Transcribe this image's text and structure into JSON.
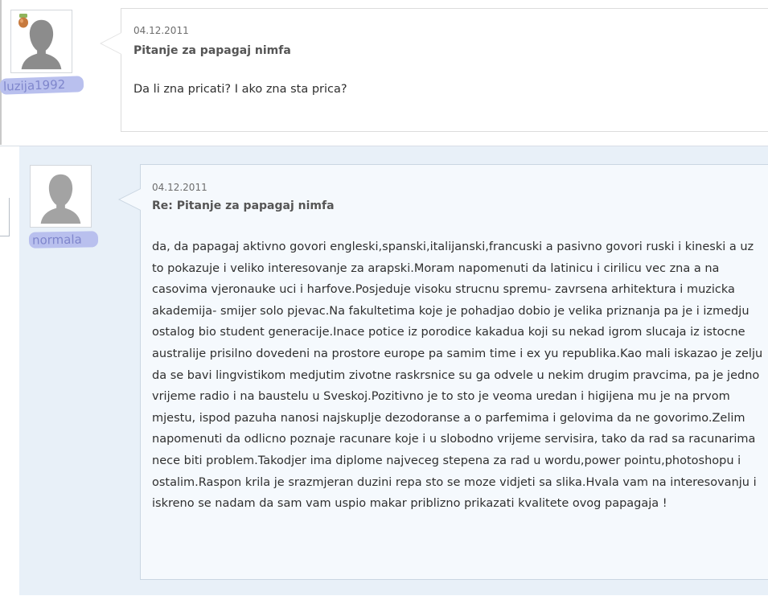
{
  "posts": [
    {
      "username": "luzija1992",
      "date": "04.12.2011",
      "title": "Pitanje za papagaj nimfa",
      "body": "Da li zna pricati? I ako zna sta prica?"
    },
    {
      "username": "normala",
      "date": "04.12.2011",
      "title": "Re: Pitanje za papagaj nimfa",
      "body": "da, da papagaj aktivno govori engleski,spanski,italijanski,francuski a pasivno govori ruski i kineski a uz to pokazuje i veliko interesovanje za arapski.Moram napomenuti da latinicu i cirilicu vec zna a na casovima vjeronauke uci i harfove.Posjeduje visoku strucnu spremu- zavrsena arhitektura i muzicka akademija- smijer solo pjevac.Na fakultetima koje je pohadjao dobio je velika priznanja pa je i izmedju ostalog bio student generacije.Inace potice iz porodice kakadua koji su nekad igrom slucaja iz istocne australije prisilno dovedeni na prostore europe pa samim time i ex yu republika.Kao mali iskazao je zelju da se bavi lingvistikom medjutim zivotne raskrsnice su ga odvele u nekim drugim pravcima, pa je jedno vrijeme radio i na baustelu u Sveskoj.Pozitivno je to sto je veoma uredan i higijena mu je na prvom mjestu, ispod pazuha nanosi najskuplje dezodoranse a o parfemima i gelovima da ne govorimo.Zelim napomenuti da odlicno poznaje racunare koje i u slobodno vrijeme servisira, tako da rad sa racunarima nece biti problem.Takodjer ima diplome najveceg stepena za rad u wordu,power pointu,photoshopu i ostalim.Raspon krila je srazmjeran duzini repa sto se moze vidjeti sa slika.Hvala vam na interesovanju i iskreno se nadam da sam vam uspio makar priblizno prikazati kvalitete ovog papagaja !"
    }
  ],
  "icons": {
    "avatar": "default-user-silhouette",
    "badge": "acorn-badge-icon"
  },
  "colors": {
    "post2_background": "#e8f0f8",
    "bubble2_background": "#f5f9fd",
    "username_highlight": "#b9c0ee",
    "username_text": "#7f86cc"
  }
}
